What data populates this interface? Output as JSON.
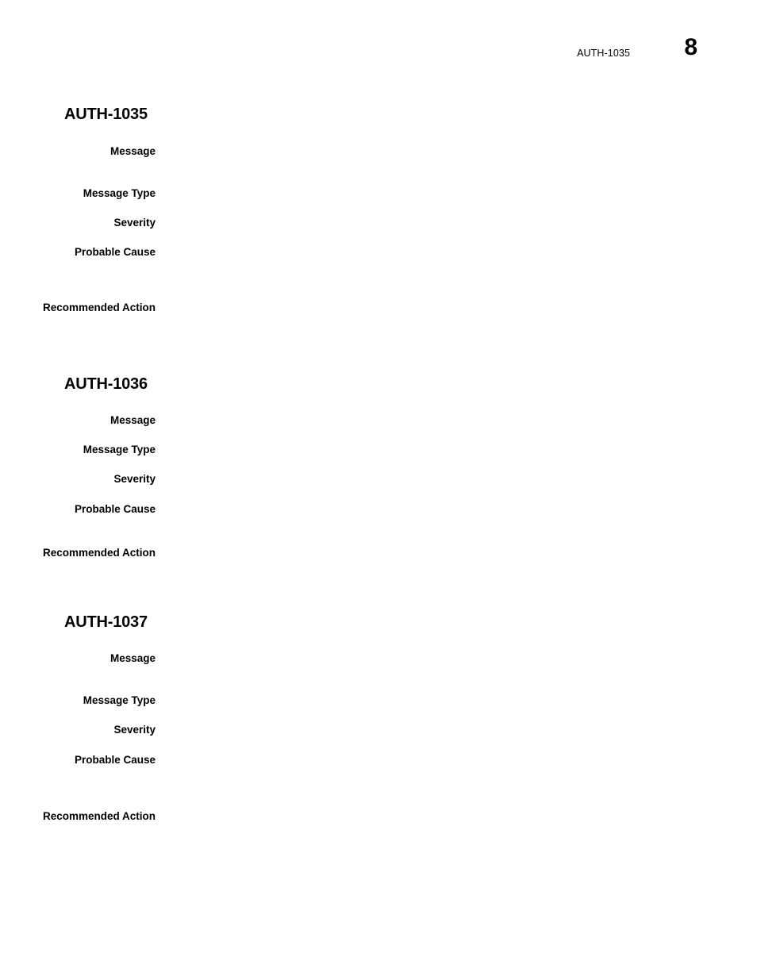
{
  "page": {
    "running_title": "AUTH-1035",
    "page_number": "8",
    "background_color": "#ffffff",
    "text_color": "#000000"
  },
  "sections": [
    {
      "heading": "AUTH-1035",
      "fields": [
        {
          "label": "Message",
          "value": ""
        },
        {
          "label": "Message Type",
          "value": ""
        },
        {
          "label": "Severity",
          "value": ""
        },
        {
          "label": "Probable Cause",
          "value": ""
        },
        {
          "label": "Recommended Action",
          "value": ""
        }
      ]
    },
    {
      "heading": "AUTH-1036",
      "fields": [
        {
          "label": "Message",
          "value": ""
        },
        {
          "label": "Message Type",
          "value": ""
        },
        {
          "label": "Severity",
          "value": ""
        },
        {
          "label": "Probable Cause",
          "value": ""
        },
        {
          "label": "Recommended Action",
          "value": ""
        }
      ]
    },
    {
      "heading": "AUTH-1037",
      "fields": [
        {
          "label": "Message",
          "value": ""
        },
        {
          "label": "Message Type",
          "value": ""
        },
        {
          "label": "Severity",
          "value": ""
        },
        {
          "label": "Probable Cause",
          "value": ""
        },
        {
          "label": "Recommended Action",
          "value": ""
        }
      ]
    }
  ],
  "layout": {
    "section_tops": [
      133,
      473,
      773
    ],
    "field_tops": [
      [
        49,
        102,
        139,
        176,
        246
      ],
      [
        48,
        85,
        122,
        160,
        215
      ],
      [
        48,
        101,
        138,
        176,
        247
      ]
    ]
  }
}
